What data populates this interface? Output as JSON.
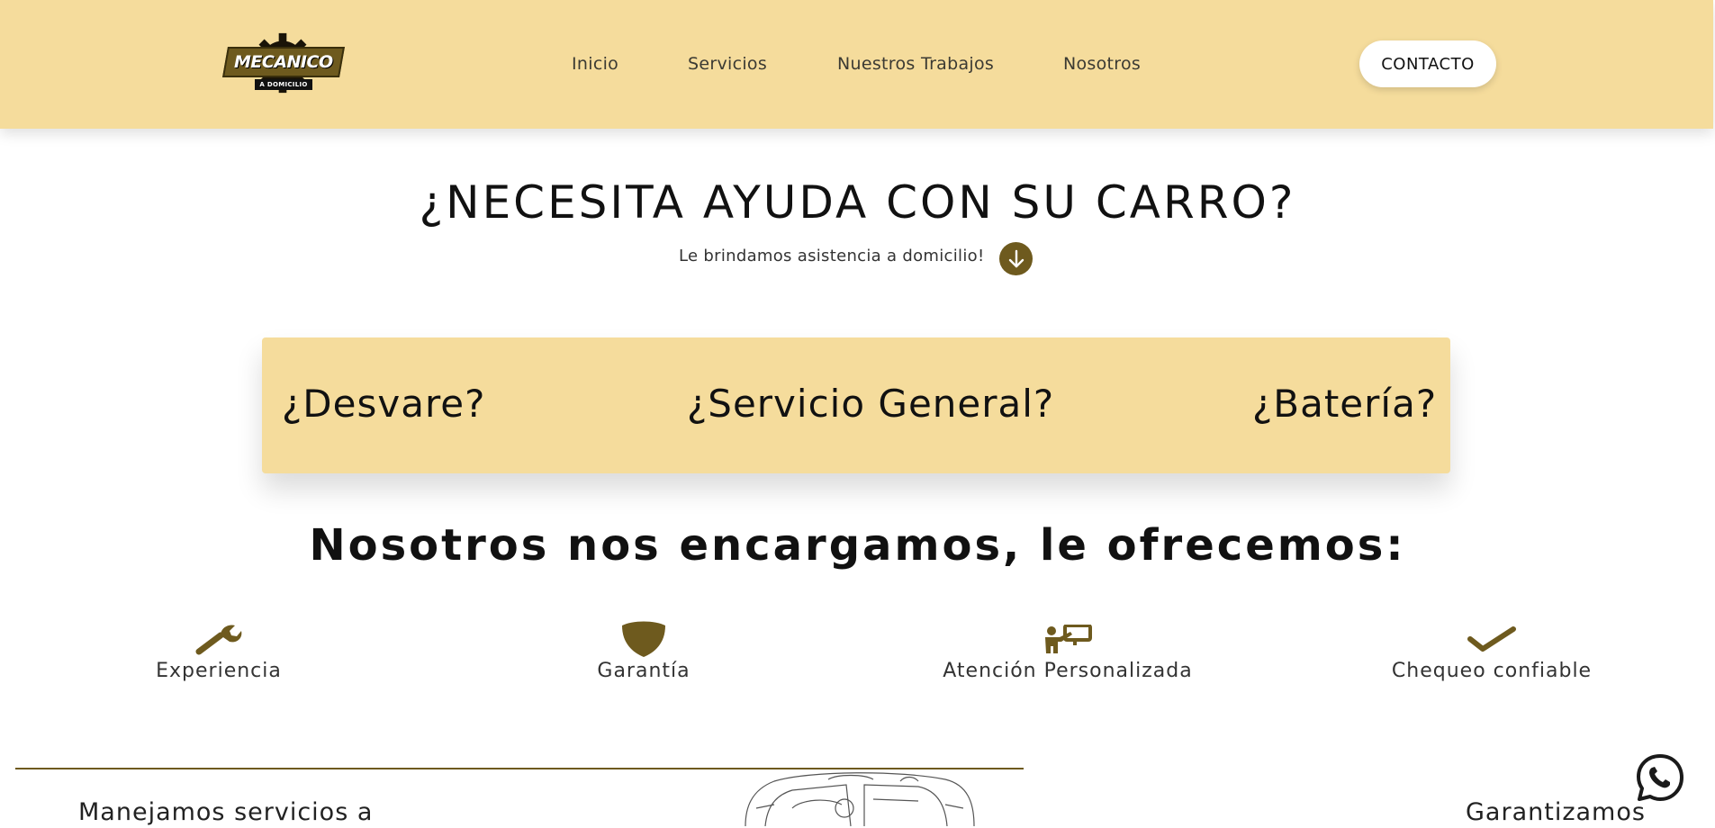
{
  "brand": {
    "logo_text": "MECANICO",
    "logo_subtext": "A DOMICILIO",
    "accent": "#6e5a1e",
    "header_bg": "#f5dc9c"
  },
  "nav": {
    "items": [
      {
        "label": "Inicio"
      },
      {
        "label": "Servicios"
      },
      {
        "label": "Nuestros Trabajos"
      },
      {
        "label": "Nosotros"
      }
    ],
    "contact_label": "CONTACTO"
  },
  "hero": {
    "title": "¿NECESITA AYUDA CON SU CARRO?",
    "subtitle": "Le brindamos asistencia a domicilio!",
    "scroll_icon": "arrow-down-icon"
  },
  "questions": [
    {
      "label": "¿Desvare?"
    },
    {
      "label": "¿Servicio General?"
    },
    {
      "label": "¿Batería?"
    }
  ],
  "offer": {
    "title": "Nosotros nos encargamos, le ofrecemos:",
    "features": [
      {
        "icon": "wrench-icon",
        "label": "Experiencia"
      },
      {
        "icon": "shield-icon",
        "label": "Garantía"
      },
      {
        "icon": "presenter-icon",
        "label": "Atención Personalizada"
      },
      {
        "icon": "checkmark-icon",
        "label": "Chequeo confiable"
      }
    ]
  },
  "bottom": {
    "left_text": "Manejamos servicios a",
    "right_text": "Garantizamos"
  },
  "floating": {
    "whatsapp_icon": "whatsapp-icon"
  }
}
